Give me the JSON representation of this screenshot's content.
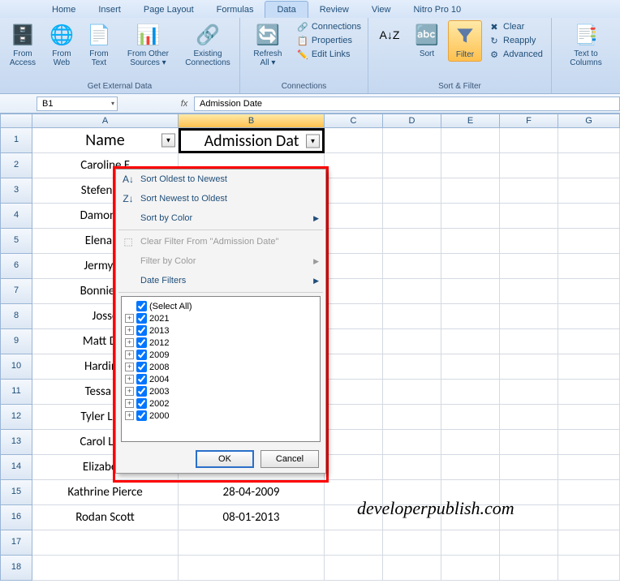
{
  "tabs": [
    "Home",
    "Insert",
    "Page Layout",
    "Formulas",
    "Data",
    "Review",
    "View",
    "Nitro Pro 10"
  ],
  "active_tab": 4,
  "ribbon": {
    "ext_data": {
      "label": "Get External Data",
      "access": "From Access",
      "web": "From Web",
      "text": "From Text",
      "other": "From Other Sources ▾",
      "existing": "Existing Connections"
    },
    "conn": {
      "label": "Connections",
      "refresh": "Refresh All ▾",
      "connections": "Connections",
      "properties": "Properties",
      "editlinks": "Edit Links"
    },
    "sortfilter": {
      "label": "Sort & Filter",
      "sort": "Sort",
      "filter": "Filter",
      "clear": "Clear",
      "reapply": "Reapply",
      "advanced": "Advanced"
    },
    "tools": {
      "texttocol": "Text to Columns"
    }
  },
  "namebox": "B1",
  "formula": "Admission Date",
  "columns": [
    "A",
    "B",
    "C",
    "D",
    "E",
    "F",
    "G"
  ],
  "rows": [
    {
      "n": "1",
      "a": "Name",
      "b": "Admission Dat"
    },
    {
      "n": "2",
      "a": "Caroline F",
      "b": ""
    },
    {
      "n": "3",
      "a": "Stefen Sal",
      "b": ""
    },
    {
      "n": "4",
      "a": "Damon Sa",
      "b": ""
    },
    {
      "n": "5",
      "a": "Elena Gi",
      "b": ""
    },
    {
      "n": "6",
      "a": "Jermy Gi",
      "b": ""
    },
    {
      "n": "7",
      "a": "Bonnie Be",
      "b": ""
    },
    {
      "n": "8",
      "a": "Josse",
      "b": ""
    },
    {
      "n": "9",
      "a": "Matt Dor",
      "b": ""
    },
    {
      "n": "10",
      "a": "Hardin S",
      "b": ""
    },
    {
      "n": "11",
      "a": "Tessa Yo",
      "b": ""
    },
    {
      "n": "12",
      "a": "Tyler Lock",
      "b": ""
    },
    {
      "n": "13",
      "a": "Carol Lock",
      "b": ""
    },
    {
      "n": "14",
      "a": "Elizabeth",
      "b": ""
    },
    {
      "n": "15",
      "a": "Kathrine Pierce",
      "b": "28-04-2009"
    },
    {
      "n": "16",
      "a": "Rodan Scott",
      "b": "08-01-2013"
    },
    {
      "n": "17",
      "a": "",
      "b": ""
    },
    {
      "n": "18",
      "a": "",
      "b": ""
    }
  ],
  "dropdown": {
    "sort_asc": "Sort Oldest to Newest",
    "sort_desc": "Sort Newest to Oldest",
    "sort_color": "Sort by Color",
    "clear_filter": "Clear Filter From \"Admission Date\"",
    "filter_color": "Filter by Color",
    "date_filters": "Date Filters",
    "select_all": "(Select All)",
    "years": [
      "2021",
      "2013",
      "2012",
      "2009",
      "2008",
      "2004",
      "2003",
      "2002",
      "2000"
    ],
    "ok": "OK",
    "cancel": "Cancel"
  },
  "watermark": "developerpublish.com"
}
